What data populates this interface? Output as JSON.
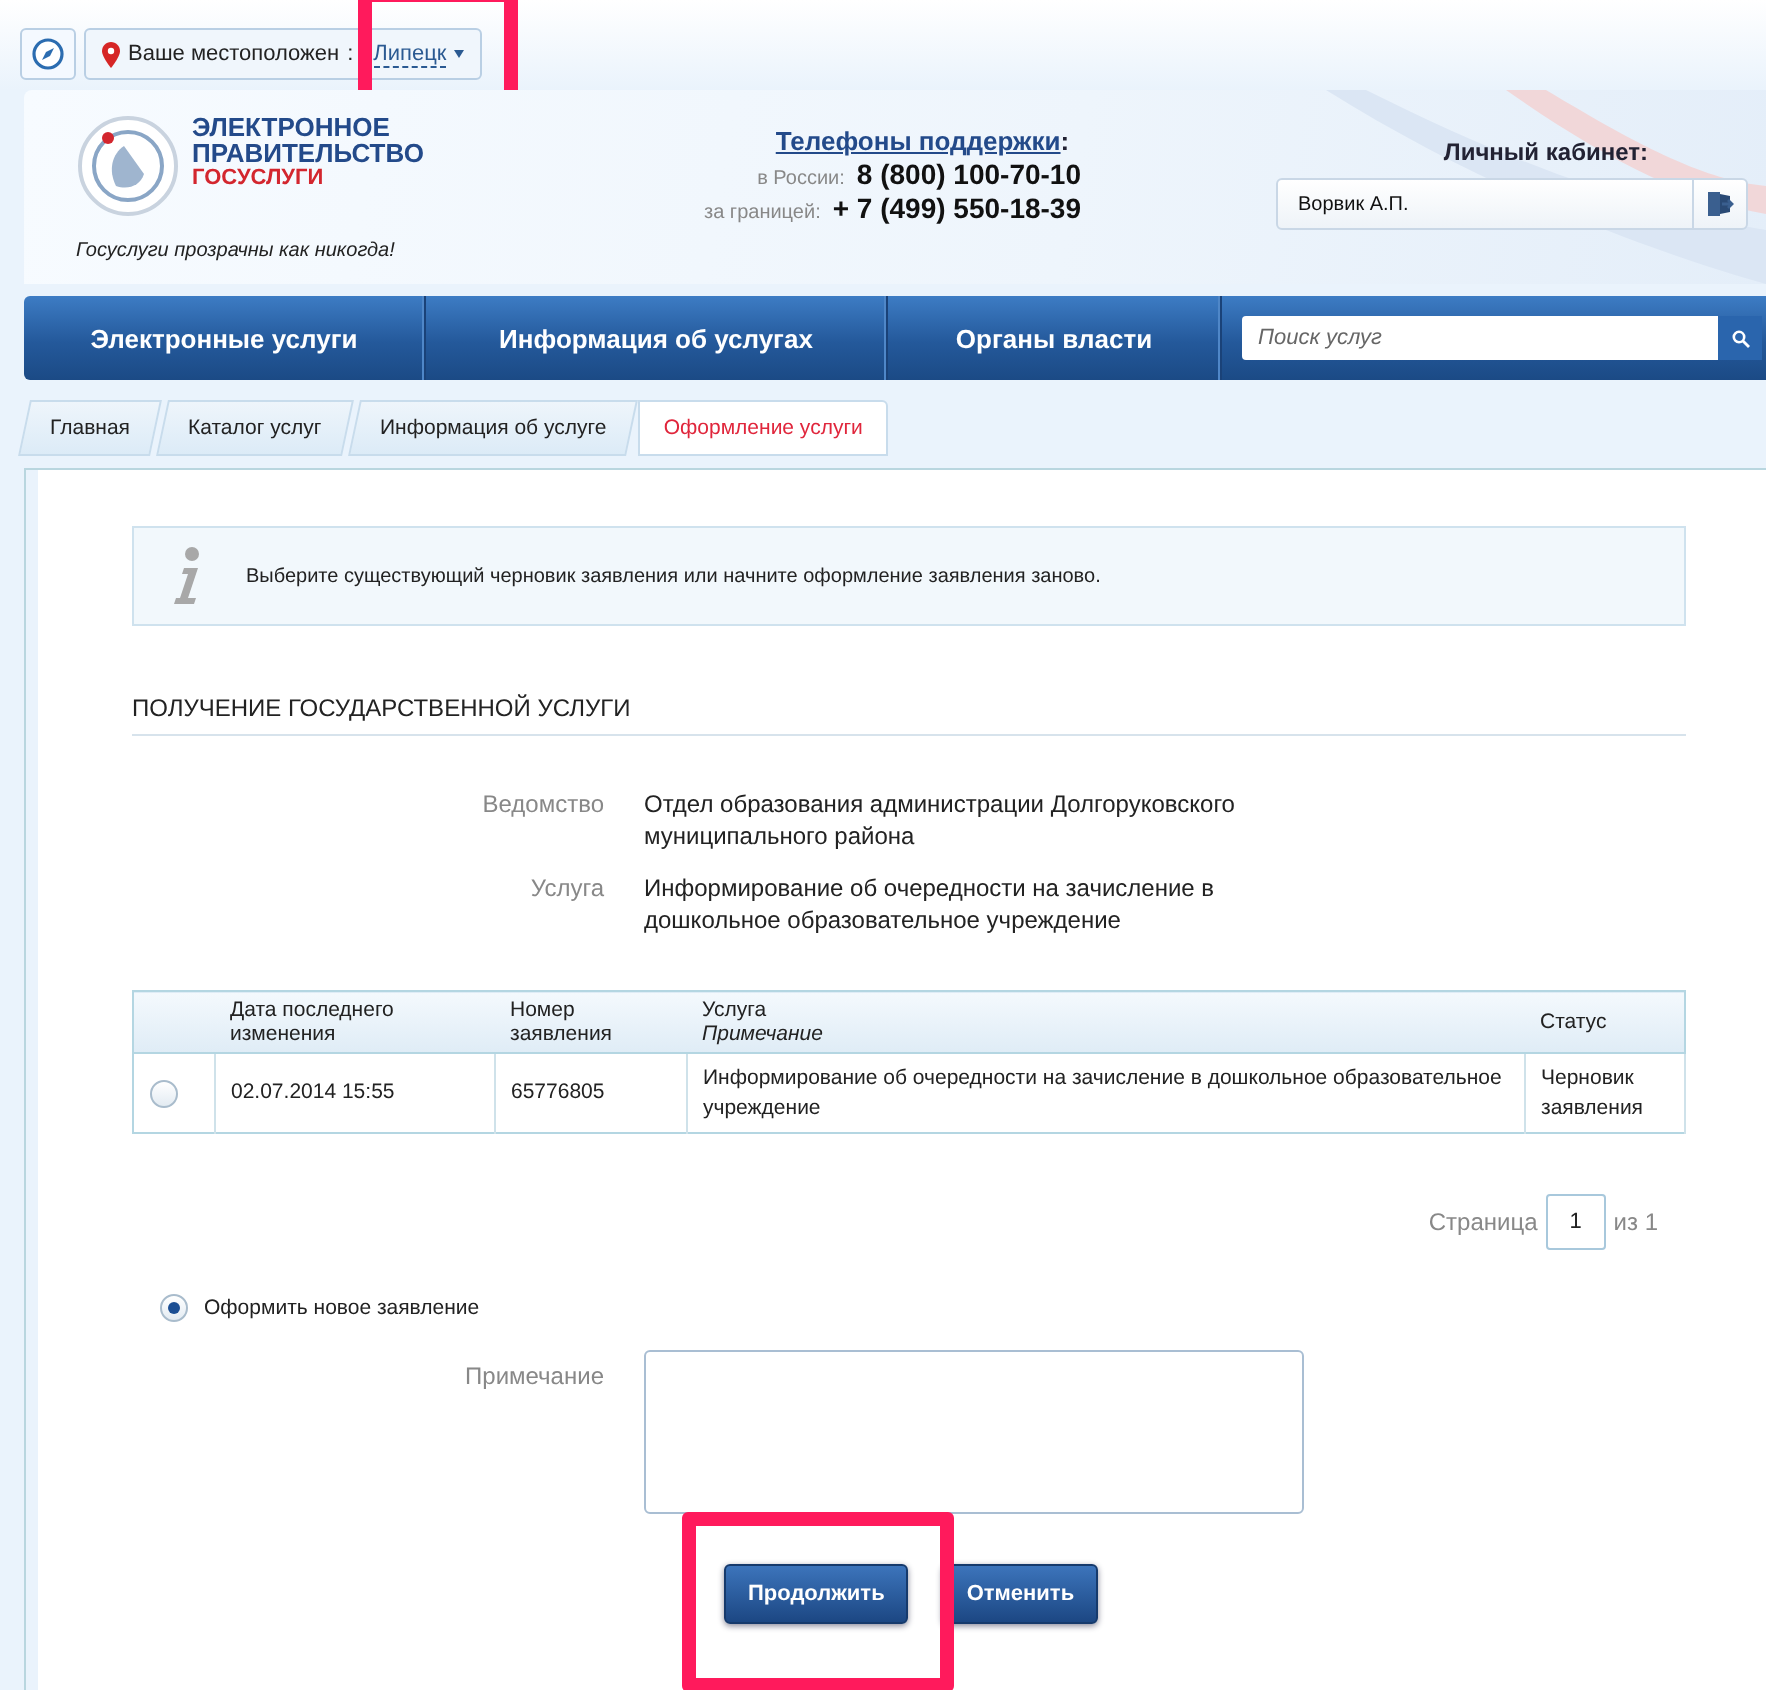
{
  "location_bar": {
    "label": "Ваше местоположен",
    "separator": ":",
    "city": "Липецк",
    "highlighted": true
  },
  "header": {
    "logo": [
      "ЭЛЕКТРОННОЕ",
      "ПРАВИТЕЛЬСТВО",
      "ГОСУСЛУГИ"
    ],
    "slogan": "Госуслуги прозрачны как никогда!",
    "support": {
      "title": "Телефоны поддержки",
      "colon": ":",
      "phones": [
        {
          "label": "в России:",
          "number": "8 (800) 100-70-10"
        },
        {
          "label": "за границей:",
          "number": "+ 7 (499) 550-18-39"
        }
      ]
    },
    "cabinet": {
      "title": "Личный кабинет:",
      "user": "Ворвик А.П."
    }
  },
  "nav": {
    "items": [
      "Электронные услуги",
      "Информация об услугах",
      "Органы власти"
    ],
    "search": {
      "placeholder": "Поиск услуг"
    }
  },
  "breadcrumbs": [
    {
      "label": "Главная",
      "selected": false
    },
    {
      "label": "Каталог услуг",
      "selected": false
    },
    {
      "label": "Информация об услуге",
      "selected": false
    },
    {
      "label": "Оформление услуги",
      "selected": true
    }
  ],
  "info": "Выберите существующий черновик заявления или начните оформление заявления заново.",
  "section_title": "ПОЛУЧЕНИЕ ГОСУДАРСТВЕННОЙ УСЛУГИ",
  "fields": [
    {
      "label": "Ведомство",
      "value": "Отдел образования администрации Долгоруковского муниципального района"
    },
    {
      "label": "Услуга",
      "value": "Информирование об очередности на зачисление в дошкольное образовательное учреждение"
    }
  ],
  "table": {
    "columns": [
      {
        "title": "Дата последнего изменения"
      },
      {
        "title": "Номер заявления"
      },
      {
        "title": "Услуга",
        "subtitle": "Примечание"
      },
      {
        "title": "Статус"
      }
    ],
    "rows": [
      {
        "selected": false,
        "cells": [
          "02.07.2014 15:55",
          "65776805",
          "Информирование об очередности на зачисление в дошкольное образовательное учреждение",
          "Черновик заявления"
        ]
      }
    ]
  },
  "pagination": {
    "label": "Страница",
    "page": "1",
    "total": "из 1"
  },
  "new_application": {
    "label": "Оформить новое заявление",
    "selected": true
  },
  "note": {
    "label": "Примечание"
  },
  "buttons": [
    {
      "label": "Продолжить",
      "highlighted": true
    },
    {
      "label": "Отменить",
      "highlighted": false
    }
  ]
}
